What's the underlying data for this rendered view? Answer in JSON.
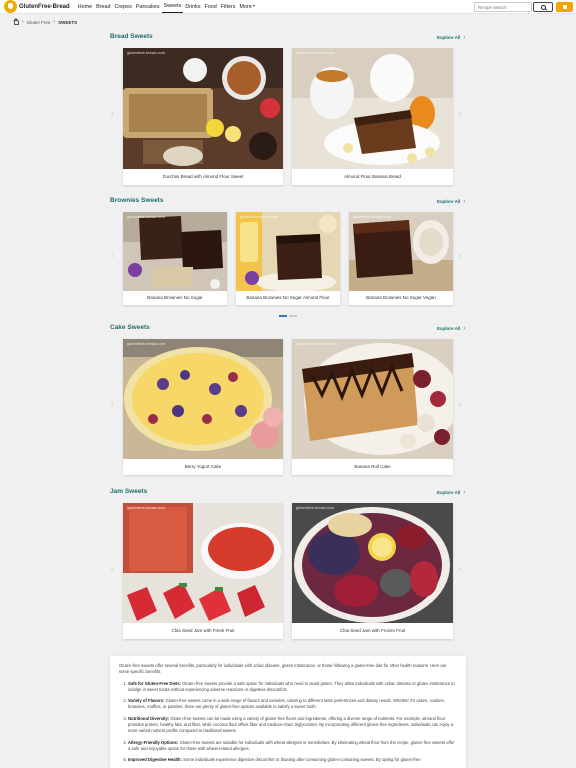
{
  "nav": {
    "logo_text": "GlutenFree-Bread",
    "items": [
      "Home",
      "Bread",
      "Crepes",
      "Pancakes",
      "Sweets",
      "Drinks",
      "Food",
      "Filters",
      "More"
    ],
    "search_placeholder": "Recipe search"
  },
  "breadcrumb": {
    "parent": "Gluten Free",
    "current": "SWEETS"
  },
  "watermark": "glutenfree-bread.com",
  "sections": [
    {
      "title": "Bread Sweets",
      "explore": "Explore All",
      "cards": [
        "Zucchini Bread with Almond Flour Sweet",
        "Almond Flour Banana Bread"
      ]
    },
    {
      "title": "Brownies Sweets",
      "explore": "Explore All",
      "cards": [
        "Banana Brownies No Sugar",
        "Banana Brownies No Sugar Almond Flour",
        "Banana Brownies No Sugar Vegan"
      ]
    },
    {
      "title": "Cake Sweets",
      "explore": "Explore All",
      "cards": [
        "Berry Yogurt Cake",
        "Banana Roll Cake"
      ]
    },
    {
      "title": "Jam Sweets",
      "explore": "Explore All",
      "cards": [
        "Chia Seed Jam with Fresh Fruit",
        "Chia Seed Jam with Frozen Fruit"
      ]
    }
  ],
  "info": {
    "intro": "Gluten-free sweets offer several benefits, particularly for individuals with celiac disease, gluten intolerance, or those following a gluten-free diet for other health reasons. Here are some specific benefits:",
    "points": [
      {
        "title": "Safe for Gluten-Free Diets:",
        "text": "Gluten-free sweets provide a safe option for individuals who need to avoid gluten. They allow individuals with celiac disease or gluten intolerance to indulge in sweet treats without experiencing adverse reactions or digestive discomfort."
      },
      {
        "title": "Variety of Flavors:",
        "text": "Gluten-free sweets come in a wide range of flavors and varieties, catering to different taste preferences and dietary needs. Whether it's cakes, cookies, brownies, muffins, or pastries, there are plenty of gluten-free options available to satisfy a sweet tooth."
      },
      {
        "title": "Nutritional Diversity:",
        "text": "Gluten-free sweets can be made using a variety of gluten-free flours and ingredients, offering a diverse range of nutrients. For example, almond flour provides protein, healthy fats, and fiber, while coconut flour offers fiber and medium-chain triglycerides. By incorporating different gluten-free ingredients, individuals can enjoy a more varied nutrient profile compared to traditional sweets."
      },
      {
        "title": "Allergy-Friendly Options:",
        "text": "Gluten-free sweets are suitable for individuals with wheat allergies or sensitivities. By eliminating wheat flour from the recipe, gluten-free sweets offer a safe and enjoyable option for those with wheat-related allergies."
      },
      {
        "title": "Improved Digestive Health:",
        "text": "Some individuals experience digestive discomfort or bloating after consuming gluten-containing sweets. By opting for gluten-free"
      }
    ]
  },
  "colors": {
    "accent": "#f0a500",
    "section_title": "#1d6e6a",
    "dot_active": "#3e7ba7"
  }
}
